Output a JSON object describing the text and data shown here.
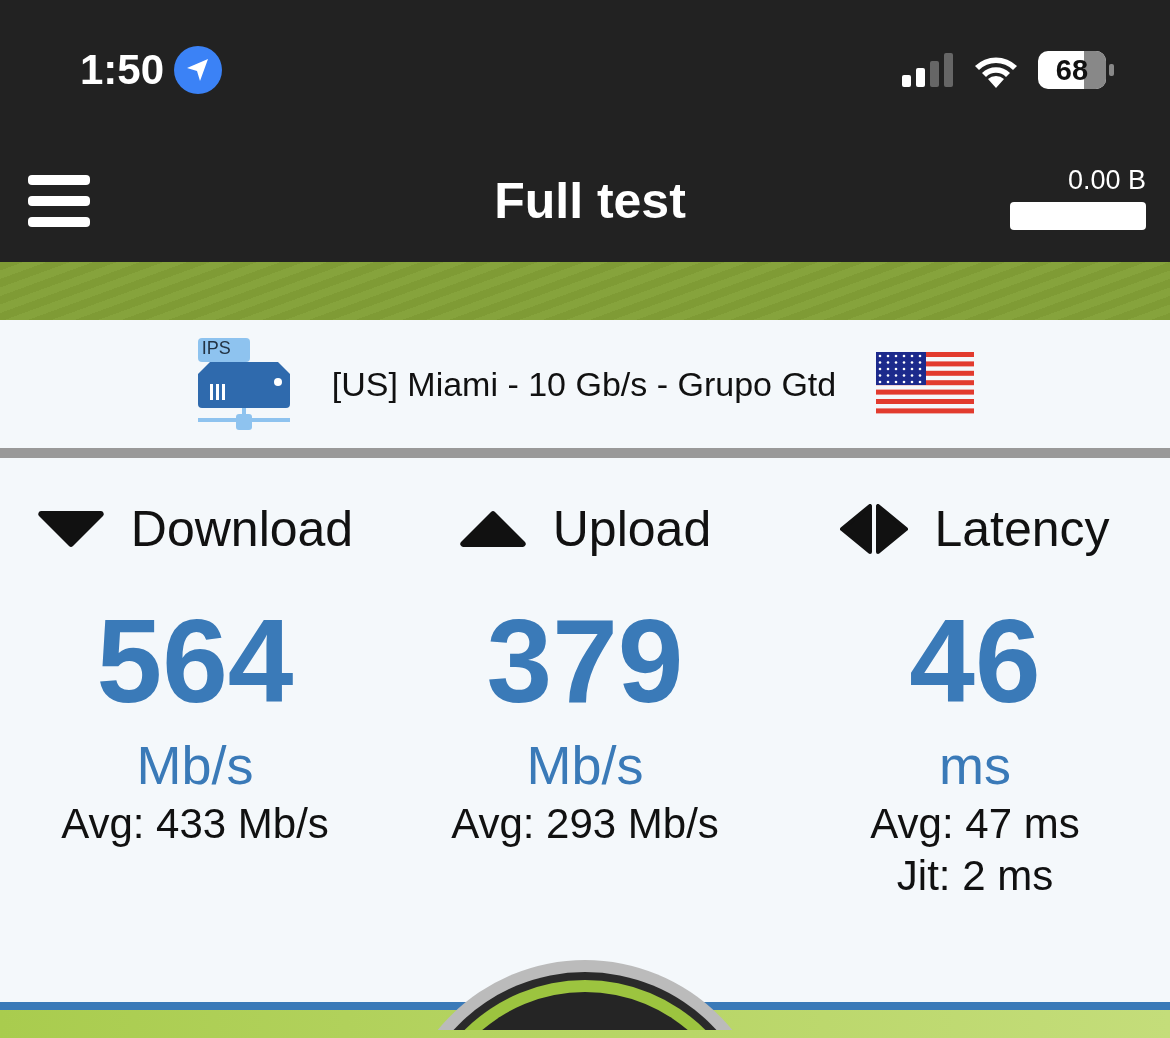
{
  "status_bar": {
    "time": "1:50",
    "battery": "68"
  },
  "header": {
    "title": "Full test",
    "data_used": "0.00 B"
  },
  "server": {
    "label": "[US] Miami - 10 Gb/s - Grupo Gtd",
    "badge": "IPS"
  },
  "metrics": [
    {
      "kind": "download",
      "label": "Download",
      "value": "564",
      "unit": "Mb/s",
      "details": [
        "Avg: 433 Mb/s"
      ]
    },
    {
      "kind": "upload",
      "label": "Upload",
      "value": "379",
      "unit": "Mb/s",
      "details": [
        "Avg: 293 Mb/s"
      ]
    },
    {
      "kind": "latency",
      "label": "Latency",
      "value": "46",
      "unit": "ms",
      "details": [
        "Avg: 47 ms",
        "Jit: 2 ms"
      ]
    }
  ]
}
